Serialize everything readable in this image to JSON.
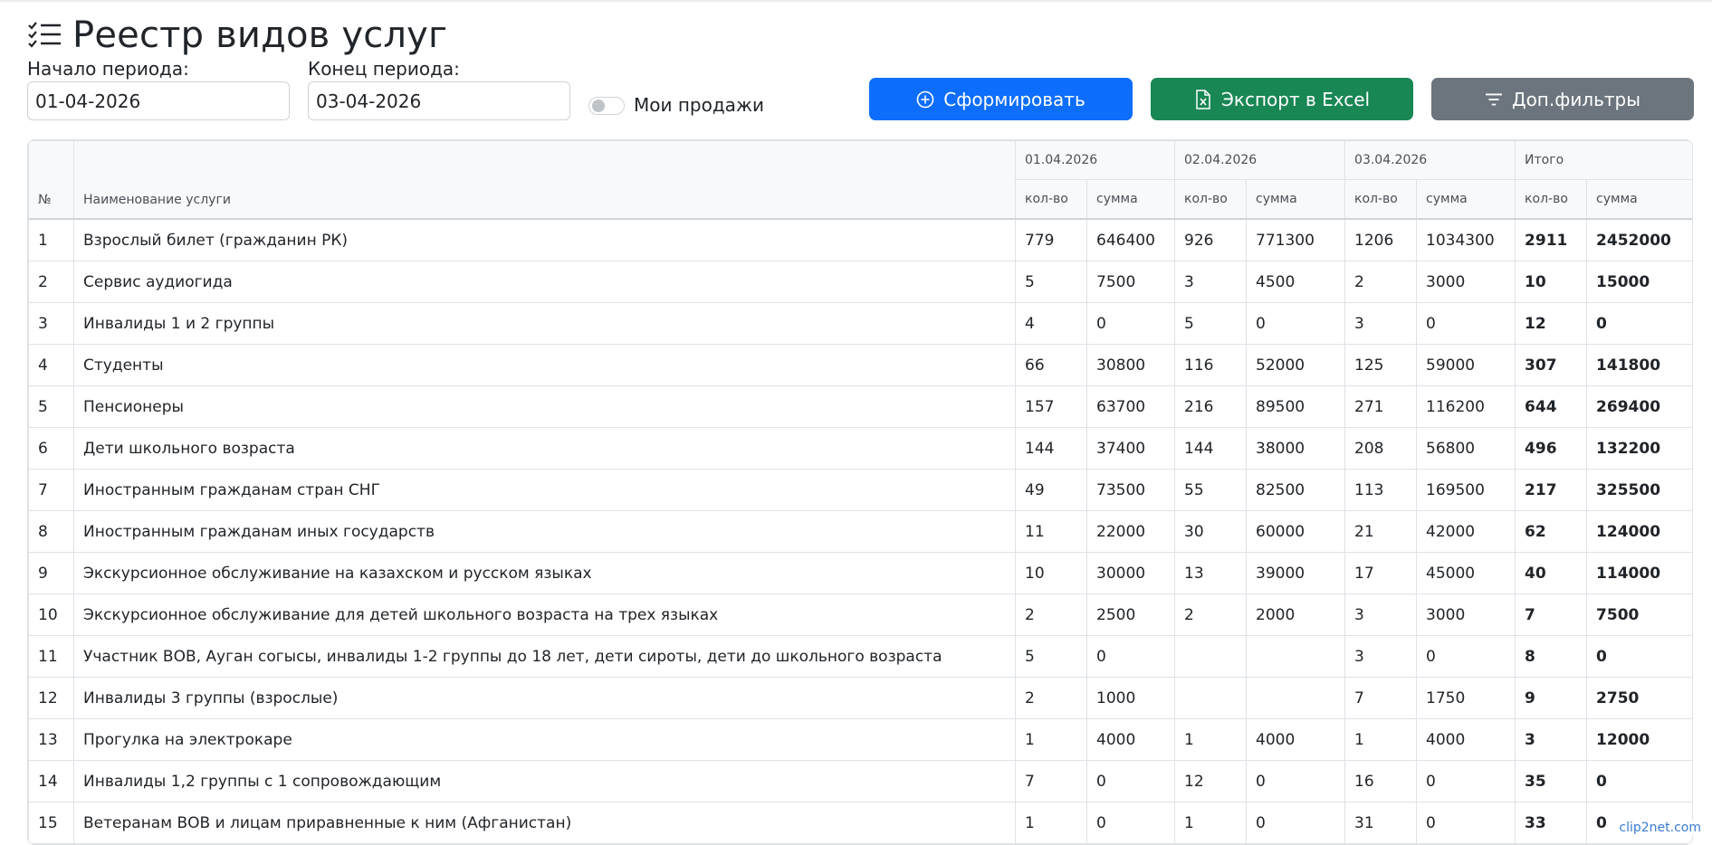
{
  "page": {
    "title": "Реестр видов услуг"
  },
  "filters": {
    "start_label": "Начало периода:",
    "start_value": "01-04-2026",
    "end_label": "Конец периода:",
    "end_value": "03-04-2026",
    "my_sales_label": "Мои продажи",
    "my_sales_checked": false
  },
  "buttons": {
    "generate": "Сформировать",
    "export": "Экспорт в Excel",
    "more_filters": "Доп.фильтры"
  },
  "colors": {
    "primary": "#0d6efd",
    "success": "#198754",
    "secondary": "#6c757d"
  },
  "table": {
    "col_num": "№",
    "col_name": "Наименование услуги",
    "dates": [
      "01.04.2026",
      "02.04.2026",
      "03.04.2026"
    ],
    "total_label": "Итого",
    "sub_qty": "кол-во",
    "sub_sum": "сумма",
    "rows": [
      {
        "n": "1",
        "name": "Взрослый билет (гражданин РК)",
        "q1": "779",
        "s1": "646400",
        "q2": "926",
        "s2": "771300",
        "q3": "1206",
        "s3": "1034300",
        "tq": "2911",
        "ts": "2452000"
      },
      {
        "n": "2",
        "name": "Сервис аудиогида",
        "q1": "5",
        "s1": "7500",
        "q2": "3",
        "s2": "4500",
        "q3": "2",
        "s3": "3000",
        "tq": "10",
        "ts": "15000"
      },
      {
        "n": "3",
        "name": "Инвалиды 1 и 2 группы",
        "q1": "4",
        "s1": "0",
        "q2": "5",
        "s2": "0",
        "q3": "3",
        "s3": "0",
        "tq": "12",
        "ts": "0"
      },
      {
        "n": "4",
        "name": "Студенты",
        "q1": "66",
        "s1": "30800",
        "q2": "116",
        "s2": "52000",
        "q3": "125",
        "s3": "59000",
        "tq": "307",
        "ts": "141800"
      },
      {
        "n": "5",
        "name": "Пенсионеры",
        "q1": "157",
        "s1": "63700",
        "q2": "216",
        "s2": "89500",
        "q3": "271",
        "s3": "116200",
        "tq": "644",
        "ts": "269400"
      },
      {
        "n": "6",
        "name": "Дети школьного возраста",
        "q1": "144",
        "s1": "37400",
        "q2": "144",
        "s2": "38000",
        "q3": "208",
        "s3": "56800",
        "tq": "496",
        "ts": "132200"
      },
      {
        "n": "7",
        "name": "Иностранным гражданам стран СНГ",
        "q1": "49",
        "s1": "73500",
        "q2": "55",
        "s2": "82500",
        "q3": "113",
        "s3": "169500",
        "tq": "217",
        "ts": "325500"
      },
      {
        "n": "8",
        "name": "Иностранным гражданам иных государств",
        "q1": "11",
        "s1": "22000",
        "q2": "30",
        "s2": "60000",
        "q3": "21",
        "s3": "42000",
        "tq": "62",
        "ts": "124000"
      },
      {
        "n": "9",
        "name": "Экскурсионное обслуживание на казахском и русском языках",
        "q1": "10",
        "s1": "30000",
        "q2": "13",
        "s2": "39000",
        "q3": "17",
        "s3": "45000",
        "tq": "40",
        "ts": "114000"
      },
      {
        "n": "10",
        "name": "Экскурсионное обслуживание для детей школьного возраста на трех языках",
        "q1": "2",
        "s1": "2500",
        "q2": "2",
        "s2": "2000",
        "q3": "3",
        "s3": "3000",
        "tq": "7",
        "ts": "7500"
      },
      {
        "n": "11",
        "name": "Участник ВОВ, Ауган согысы, инвалиды 1-2 группы до 18 лет, дети сироты, дети до школьного возраста",
        "q1": "5",
        "s1": "0",
        "q2": "",
        "s2": "",
        "q3": "3",
        "s3": "0",
        "tq": "8",
        "ts": "0"
      },
      {
        "n": "12",
        "name": "Инвалиды 3 группы (взрослые)",
        "q1": "2",
        "s1": "1000",
        "q2": "",
        "s2": "",
        "q3": "7",
        "s3": "1750",
        "tq": "9",
        "ts": "2750"
      },
      {
        "n": "13",
        "name": "Прогулка на электрокаре",
        "q1": "1",
        "s1": "4000",
        "q2": "1",
        "s2": "4000",
        "q3": "1",
        "s3": "4000",
        "tq": "3",
        "ts": "12000"
      },
      {
        "n": "14",
        "name": "Инвалиды 1,2 группы с 1 сопровождающим",
        "q1": "7",
        "s1": "0",
        "q2": "12",
        "s2": "0",
        "q3": "16",
        "s3": "0",
        "tq": "35",
        "ts": "0"
      },
      {
        "n": "15",
        "name": "Ветеранам ВОВ и лицам приравненные к ним (Афганистан)",
        "q1": "1",
        "s1": "0",
        "q2": "1",
        "s2": "0",
        "q3": "31",
        "s3": "0",
        "tq": "33",
        "ts": "0"
      }
    ]
  },
  "watermark": "clip2net.com"
}
